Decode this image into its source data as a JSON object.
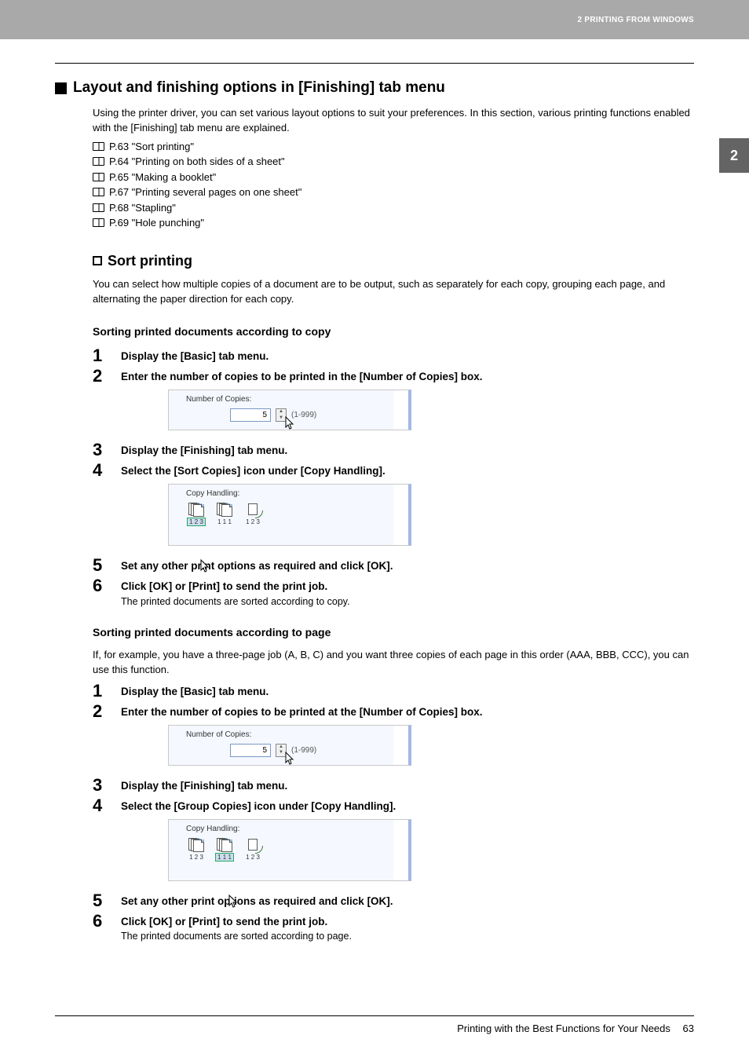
{
  "header": {
    "chapter": "2 PRINTING FROM WINDOWS",
    "tab": "2"
  },
  "section": {
    "title": "Layout and finishing options in [Finishing] tab menu",
    "intro": "Using the printer driver, you can set various layout options to suit your preferences. In this section, various printing functions enabled with the [Finishing] tab menu are explained.",
    "xrefs": [
      "P.63 \"Sort printing\"",
      "P.64 \"Printing on both sides of a sheet\"",
      "P.65 \"Making a booklet\"",
      "P.67 \"Printing several pages on one sheet\"",
      "P.68 \"Stapling\"",
      "P.69 \"Hole punching\""
    ]
  },
  "sort": {
    "title": "Sort printing",
    "intro": "You can select how multiple copies of a document are to be output, such as separately for each copy, grouping each page, and alternating the paper direction for each copy."
  },
  "procA": {
    "title": "Sorting printed documents according to copy",
    "steps": [
      {
        "title": "Display the [Basic] tab menu."
      },
      {
        "title": "Enter the number of copies to be printed in the [Number of Copies] box."
      },
      {
        "title": "Display the [Finishing] tab menu."
      },
      {
        "title": "Select the [Sort Copies] icon under [Copy Handling]."
      },
      {
        "title": "Set any other print options as required and click [OK]."
      },
      {
        "title": "Click [OK] or [Print] to send the print job.",
        "note": "The printed documents are sorted according to copy."
      }
    ]
  },
  "procB": {
    "title": "Sorting printed documents according to page",
    "intro": "If, for example, you have a three-page job (A, B, C) and you want three copies of each page in this order (AAA, BBB, CCC), you can use this function.",
    "steps": [
      {
        "title": "Display the [Basic] tab menu."
      },
      {
        "title": "Enter the number of copies to be printed at the [Number of Copies] box."
      },
      {
        "title": "Display the [Finishing] tab menu."
      },
      {
        "title": "Select the [Group Copies] icon under [Copy Handling]."
      },
      {
        "title": "Set any other print options as required and click [OK]."
      },
      {
        "title": "Click [OK] or [Print] to send the print job.",
        "note": "The printed documents are sorted according to page."
      }
    ]
  },
  "screenshots": {
    "copies_label": "Number of Copies:",
    "copies_value": "5",
    "copies_range": "(1-999)",
    "handling_label": "Copy Handling:",
    "icon_labels": [
      "1 2 3",
      "1 1 1",
      "1 2 3"
    ]
  },
  "footer": {
    "text": "Printing with the Best Functions for Your Needs",
    "page": "63"
  }
}
